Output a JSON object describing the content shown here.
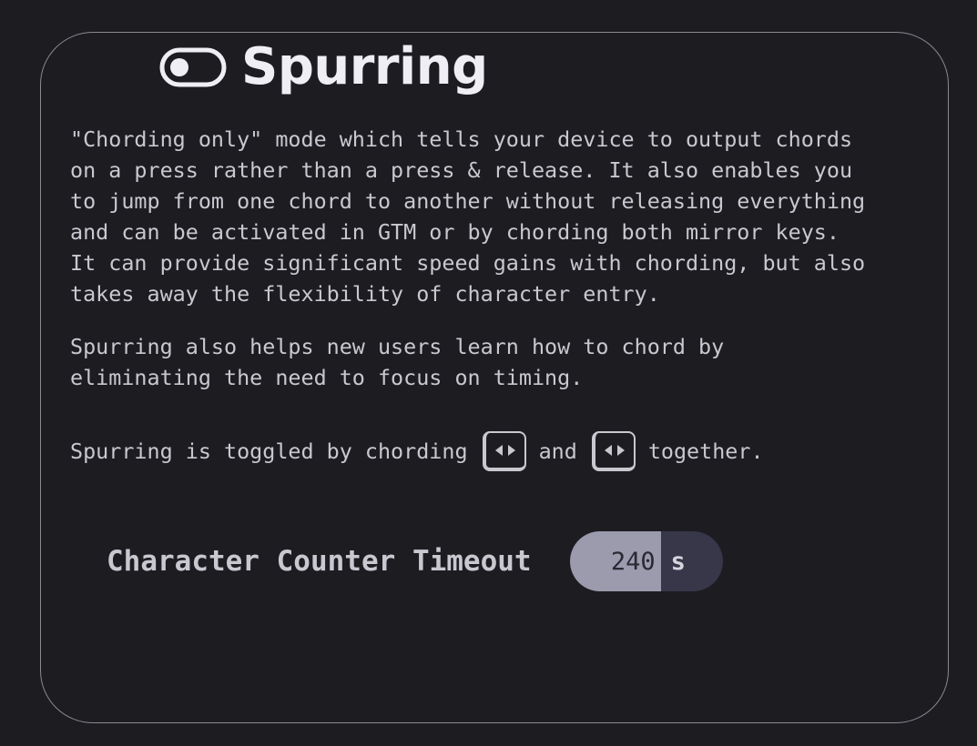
{
  "section": {
    "title": "Spurring",
    "icon": "toggle-icon"
  },
  "description": {
    "p1": "\"Chording only\" mode which tells your device to output chords\non a press rather than a press & release. It also enables you\nto jump from one chord to another without releasing everything\nand can be activated in GTM or by chording both mirror keys.\nIt can provide significant speed gains with chording, but also\ntakes away the flexibility of character entry.",
    "p2": "Spurring also helps new users learn how to chord by\neliminating the need to focus on timing.",
    "toggle_prefix": "Spurring is toggled by chording",
    "toggle_middle": "and",
    "toggle_suffix": "together.",
    "key_icon": "mirror-key-icon"
  },
  "setting": {
    "label": "Character Counter Timeout",
    "value": "240",
    "unit": "s"
  }
}
